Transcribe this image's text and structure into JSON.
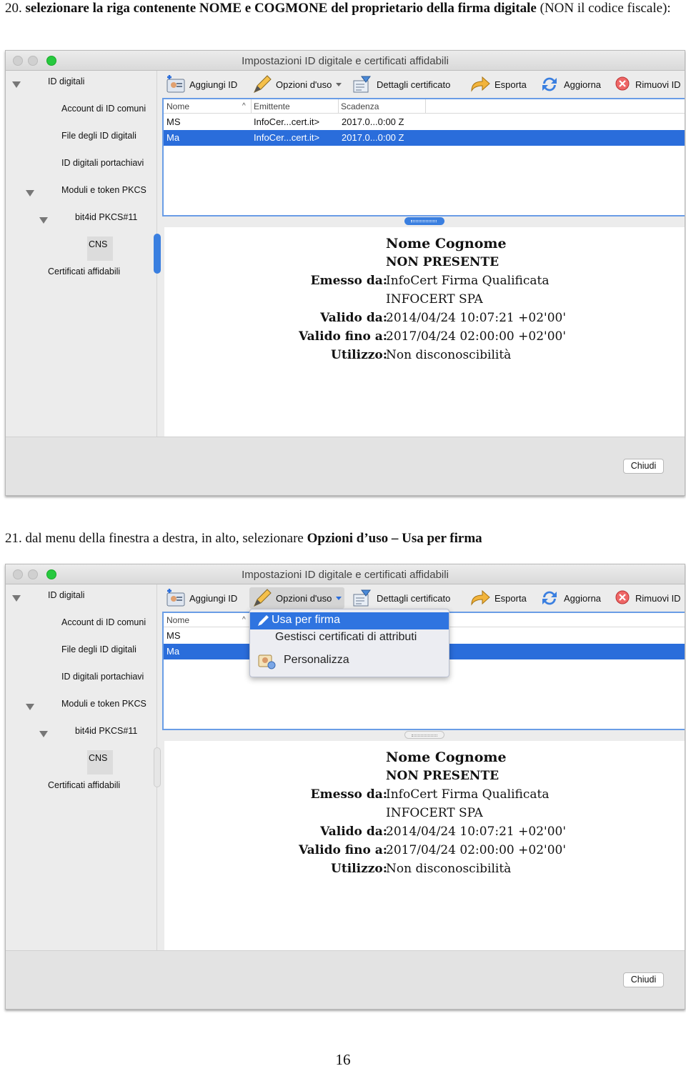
{
  "step1": {
    "number": "20.",
    "bold": "selezionare la riga contenente NOME e COGMONE del proprietario della firma digitale",
    "tail": "(NON il codice fiscale):"
  },
  "step2": {
    "prefix": "21. dal menu della finestra a destra, in alto, selezionare",
    "bold": "Opzioni d’uso – Usa per firma"
  },
  "window": {
    "title": "Impostazioni ID digitale e certificati affidabili",
    "sidebar": {
      "items": [
        "ID digitali",
        "Account di ID comuni",
        "File degli ID digitali",
        "ID digitali portachiavi",
        "Moduli e token PKCS",
        "bit4id PKCS#11",
        "CNS",
        "Certificati affidabili"
      ]
    },
    "toolbar": {
      "add_id": "Aggiungi ID",
      "usage_options": "Opzioni d'uso",
      "cert_details": "Dettagli certificato",
      "export": "Esporta",
      "refresh": "Aggiorna",
      "remove_id": "Rimuovi ID"
    },
    "table": {
      "columns": [
        "Nome",
        "Emittente",
        "Scadenza"
      ],
      "rows": [
        {
          "name": "MS",
          "issuer": "InfoCer...cert.it>",
          "expiry": "2017.0...0:00 Z"
        },
        {
          "name": "Ma",
          "issuer": "InfoCer...cert.it>",
          "expiry": "2017.0...0:00 Z"
        }
      ]
    },
    "details": {
      "name": "Nome Cognome",
      "name_sub": "NON PRESENTE",
      "issued_by_label": "Emesso da:",
      "issued_by": "InfoCert Firma Qualificata",
      "issued_by_org": "INFOCERT SPA",
      "valid_from_label": "Valido da:",
      "valid_from": "2014/04/24 10:07:21 +02'00'",
      "valid_to_label": "Valido fino a:",
      "valid_to": "2017/04/24 02:00:00 +02'00'",
      "usage_label": "Utilizzo:",
      "usage": "Non disconoscibilità"
    },
    "close_button": "Chiudi",
    "menu": {
      "items": [
        "Usa per firma",
        "Gestisci certificati di attributi",
        "Personalizza"
      ]
    }
  },
  "page_number": "16",
  "colors": {
    "selection": "#2a6ddb",
    "accent_blue": "#3a7fe0",
    "menu_highlight": "#2f74e0",
    "zoom_green": "#27c93f"
  }
}
